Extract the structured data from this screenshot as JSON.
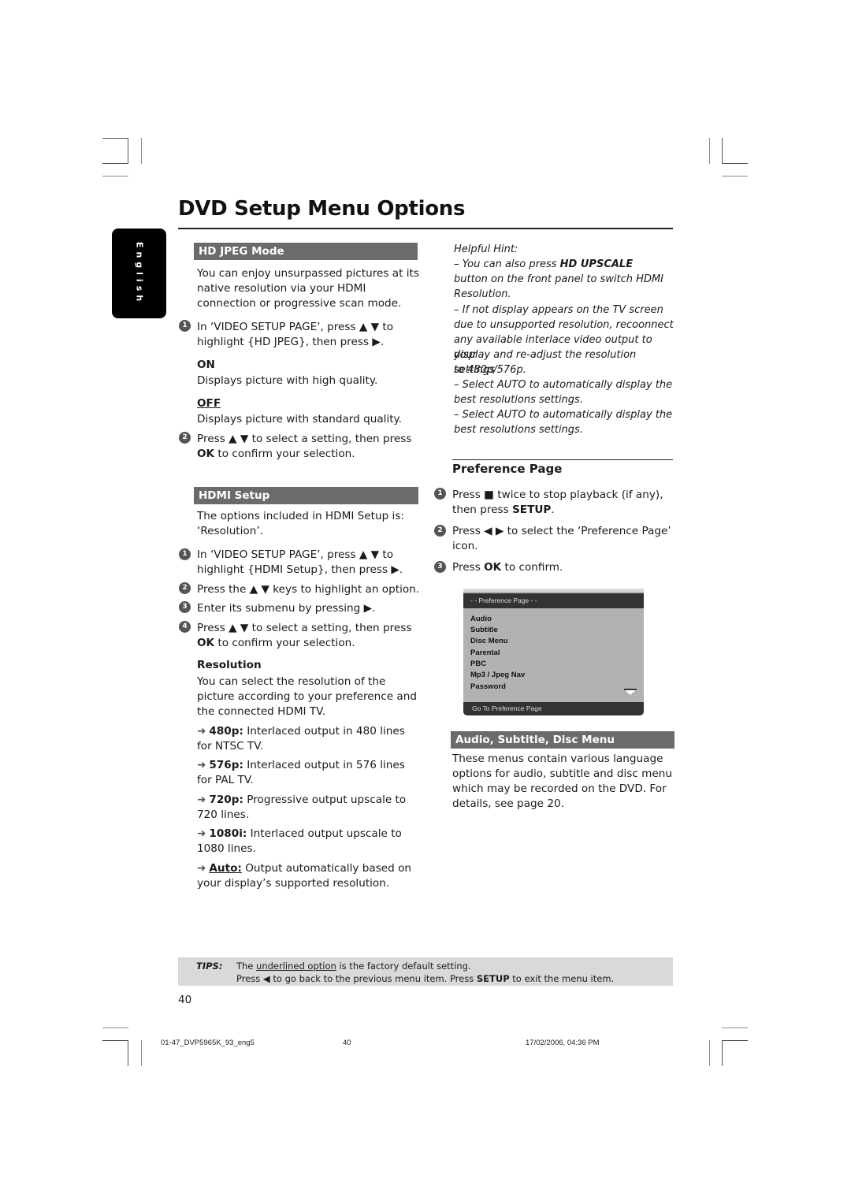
{
  "header": {
    "title": "DVD Setup Menu Options",
    "language_tab": "English"
  },
  "left": {
    "hd_jpeg": {
      "heading": "HD JPEG Mode",
      "intro": "You can enjoy unsurpassed pictures at its native resolution via your HDMI connection or progressive scan mode.",
      "step1_a": "In ‘VIDEO SETUP PAGE’, press ▲ ▼ to",
      "step1_b": "highlight {HD JPEG}, then press ▶.",
      "on_label": "ON",
      "on_desc": "Displays picture with high quality.",
      "off_label": "OFF",
      "off_desc": "Displays picture with standard quality.",
      "step2_a": "Press ▲ ▼ to select a setting, then press",
      "step2_b_bold": "OK",
      "step2_b_rest": " to confirm your selection."
    },
    "hdmi_setup": {
      "heading": "HDMI Setup",
      "intro_a": "The options included in HDMI Setup is:",
      "intro_b": "‘Resolution’.",
      "step1_a": "In ‘VIDEO SETUP PAGE’, press ▲ ▼ to",
      "step1_b": "highlight {HDMI Setup}, then press ▶.",
      "step2": "Press the ▲ ▼ keys to highlight an option.",
      "step3": "Enter its submenu by pressing ▶.",
      "step4_a": "Press ▲ ▼ to select a setting, then press",
      "step4_b_bold": "OK",
      "step4_b_rest": " to confirm your selection."
    },
    "resolution": {
      "heading": "Resolution",
      "desc_a": "You can select the resolution of the",
      "desc_b": "picture according to your preference and",
      "desc_c": "the connected HDMI TV.",
      "options": [
        {
          "label": "480p:",
          "text_a": " Interlaced output in 480 lines",
          "text_b": "for NTSC TV."
        },
        {
          "label": "576p:",
          "text_a": " Interlaced output in 576 lines",
          "text_b": "for PAL TV."
        },
        {
          "label": "720p:",
          "text_a": " Progressive output upscale to",
          "text_b": "720 lines."
        },
        {
          "label": "1080i:",
          "text_a": " Interlaced output upscale to",
          "text_b": "1080 lines."
        },
        {
          "label": "Auto:",
          "text_a": " Output automatically based on",
          "text_b": "your display’s supported resolution."
        }
      ]
    }
  },
  "right": {
    "hint": {
      "title": "Helpful Hint:",
      "h1_a_pre": "–    You can also press ",
      "h1_a_bold": "HD UPSCALE",
      "h1_b": "button on the front panel to switch HDMI",
      "h1_c": "Resolution.",
      "h2_a": "–    If not display appears on the TV screen",
      "h2_b": "due to unsupported resolution, recoonnect",
      "h2_c": "any available interlace video output to your",
      "h2_d": "display and re-adjust the resolution settings",
      "h2_e": "to 480p/576p.",
      "h3_a": "–    Select AUTO to automatically display the",
      "h3_b": "best resolutions settings.",
      "h4_a": "–    Select AUTO to automatically display the",
      "h4_b": "best resolutions settings."
    },
    "preference": {
      "heading": "Preference Page",
      "step1_a_pre": "Press ",
      "step1_a_icon": "■",
      "step1_a_rest": "  twice to stop playback (if any),",
      "step1_b_pre": "then press ",
      "step1_b_bold": "SETUP",
      "step1_b_rest": ".",
      "step2_a": "Press ◀ ▶ to select the ‘Preference Page’",
      "step2_b": "icon.",
      "step3_pre": "Press ",
      "step3_bold": "OK",
      "step3_rest": " to confirm."
    },
    "osd": {
      "header": "- -   Preference Page   - -",
      "items": [
        "Audio",
        "Subtitle",
        "Disc Menu",
        "Parental",
        "PBC",
        "Mp3 / Jpeg Nav",
        "Password"
      ],
      "footer": "Go To Preference Page",
      "scroll_icon": "down-triangle-icon"
    },
    "audio_sub": {
      "heading": "Audio, Subtitle, Disc Menu",
      "line_a": "These menus contain various language",
      "line_b": "options for audio, subtitle and disc menu",
      "line_c": "which may be recorded on the DVD.  For",
      "line_d": "details, see page 20."
    }
  },
  "tips": {
    "label": "TIPS:",
    "l1_pre": "The ",
    "l1_underlined": "underlined option",
    "l1_rest": " is the factory default setting.",
    "l2_pre": "Press ◀ to go back to the previous menu item. Press ",
    "l2_bold": "SETUP",
    "l2_rest": " to exit the menu item."
  },
  "page_number": "40",
  "footer": {
    "file": "01-47_DVP5965K_93_eng5",
    "page": "40",
    "timestamp": "17/02/2006, 04:36 PM"
  },
  "step_numbers": [
    "1",
    "2",
    "3",
    "4"
  ]
}
